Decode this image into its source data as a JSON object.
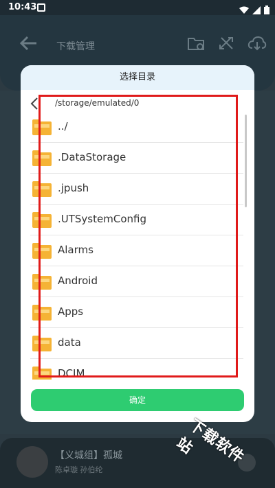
{
  "status_bar": {
    "time": "10:43"
  },
  "background_app": {
    "title": "下载管理",
    "song_title": "【义城组】孤城",
    "song_artist": "陈卓璇  孙伯纶"
  },
  "watermark": "下载软件站",
  "dialog": {
    "title": "选择目录",
    "path": "/storage/emulated/0",
    "items": [
      {
        "name": "../"
      },
      {
        "name": ".DataStorage"
      },
      {
        "name": ".jpush"
      },
      {
        "name": ".UTSystemConfig"
      },
      {
        "name": "Alarms"
      },
      {
        "name": "Android"
      },
      {
        "name": "Apps"
      },
      {
        "name": "data"
      },
      {
        "name": "DCIM"
      }
    ],
    "confirm_label": "确定"
  },
  "colors": {
    "accent": "#2ecc71",
    "folder": "#f5b335",
    "highlight": "#e01a1a",
    "header_bg": "#e7f3fb"
  }
}
